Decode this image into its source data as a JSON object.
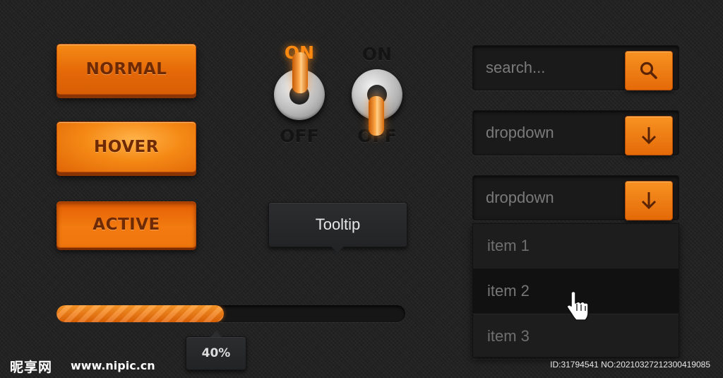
{
  "buttons": {
    "normal": "NORMAL",
    "hover": "HOVER",
    "active": "ACTIVE"
  },
  "toggles": [
    {
      "on_label": "ON",
      "off_label": "OFF",
      "state": "on"
    },
    {
      "on_label": "ON",
      "off_label": "OFF",
      "state": "off"
    }
  ],
  "tooltip": {
    "text": "Tooltip"
  },
  "progress": {
    "value": 0.48,
    "label": "40%"
  },
  "search": {
    "placeholder": "search...",
    "icon": "search-icon"
  },
  "dropdown_closed": {
    "label": "dropdown",
    "icon": "arrow-down-icon"
  },
  "dropdown_open": {
    "label": "dropdown",
    "icon": "arrow-down-icon",
    "items": [
      "item 1",
      "item 2",
      "item 3"
    ],
    "hovered_index": 1
  },
  "watermark": {
    "logo": "昵享网",
    "url": "www.nipic.cn",
    "id_text": "ID:31794541 NO:20210327212300419085"
  },
  "colors": {
    "accent": "#f07a10",
    "background": "#212121"
  }
}
